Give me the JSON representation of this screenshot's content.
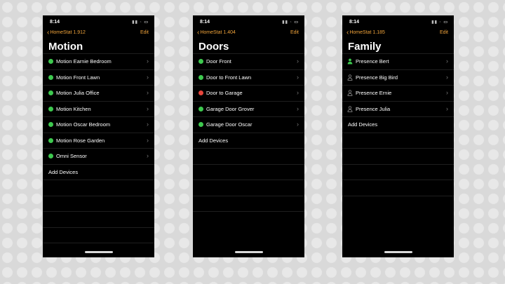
{
  "phones": [
    {
      "time": "8:14",
      "status_icons": "▮▮ ◦ ▭",
      "back_label": "HomeStat  1.912",
      "edit_label": "Edit",
      "title": "Motion",
      "items": [
        {
          "label": "Motion Earnie Bedroom",
          "color": "#3ec94f"
        },
        {
          "label": "Motion Front Lawn",
          "color": "#3ec94f"
        },
        {
          "label": "Motion Julia Office",
          "color": "#3ec94f"
        },
        {
          "label": "Motion Kitchen",
          "color": "#3ec94f"
        },
        {
          "label": "Motion Oscar Bedroom",
          "color": "#3ec94f"
        },
        {
          "label": "Motion Rose Garden",
          "color": "#3ec94f"
        },
        {
          "label": "Omni Sensor",
          "color": "#3ec94f"
        }
      ],
      "add_label": "Add Devices"
    },
    {
      "time": "8:14",
      "status_icons": "▮▮ ◦ ▭",
      "back_label": "HomeStat  1.404",
      "edit_label": "Edit",
      "title": "Doors",
      "items": [
        {
          "label": "Door Front",
          "color": "#3ec94f"
        },
        {
          "label": "Door to Front Lawn",
          "color": "#3ec94f"
        },
        {
          "label": "Door to Garage",
          "color": "#e8463c"
        },
        {
          "label": "Garage Door Grover",
          "color": "#3ec94f"
        },
        {
          "label": "Garage Door Oscar",
          "color": "#3ec94f"
        }
      ],
      "add_label": "Add Devices"
    },
    {
      "time": "8:14",
      "status_icons": "▮▮ ◦ ▭",
      "back_label": "HomeStat  1.185",
      "edit_label": "Edit",
      "title": "Family",
      "items": [
        {
          "label": "Presence Bert",
          "icon": "person-filled-icon",
          "color": "#3ec94f"
        },
        {
          "label": "Presence Big Bird",
          "icon": "person-outline-icon",
          "color": "#9a9a9a"
        },
        {
          "label": "Presence Ernie",
          "icon": "person-outline-icon",
          "color": "#9a9a9a"
        },
        {
          "label": "Presence Julia",
          "icon": "person-outline-icon",
          "color": "#9a9a9a"
        }
      ],
      "add_label": "Add Devices"
    }
  ]
}
